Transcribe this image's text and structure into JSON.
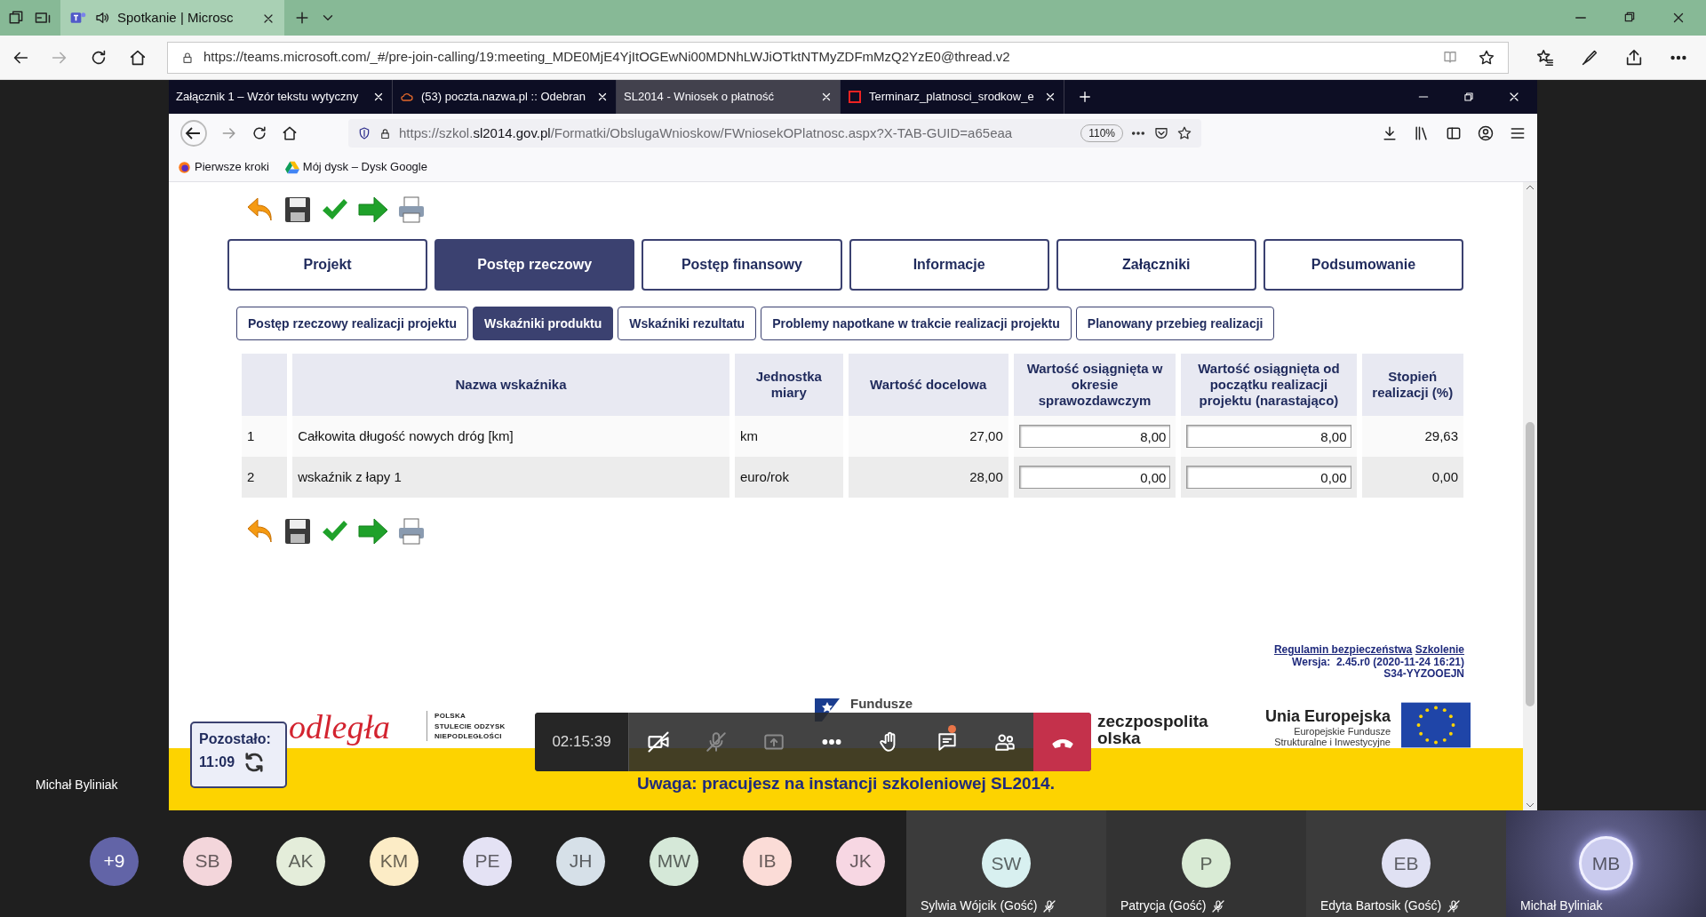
{
  "edge": {
    "tab_title": "Spotkanie | Microsc",
    "url": "https://teams.microsoft.com/_#/pre-join-calling/19:meeting_MDE0MjE4YjItOGEwNi00MDNhLWJiOTktNTMyZDFmMzQ2YzE0@thread.v2"
  },
  "firefox": {
    "tabs": [
      {
        "title": "Załącznik 1 – Wzór tekstu wytyczny",
        "selected": false,
        "kind": "plain"
      },
      {
        "title": "(53) poczta.nazwa.pl :: Odebran",
        "selected": false,
        "kind": "mail"
      },
      {
        "title": "SL2014 - Wniosek o płatność",
        "selected": true,
        "kind": "plain"
      },
      {
        "title": "Terminarz_platnosci_srodkow_e",
        "selected": false,
        "kind": "pdf"
      }
    ],
    "url": "https://szkol.**sl2014.gov.pl**/Formatki/ObslugaWnioskow/FWniosekOPlatnosc.aspx?X-TAB-GUID=a65eaa",
    "zoom": "110%",
    "bookmarks": [
      {
        "label": "Pierwsze kroki",
        "kind": "firefox"
      },
      {
        "label": "Mój dysk – Dysk Google",
        "kind": "drive"
      }
    ]
  },
  "page": {
    "main_tabs": [
      {
        "label": "Projekt",
        "selected": false
      },
      {
        "label": "Postęp rzeczowy",
        "selected": true
      },
      {
        "label": "Postęp finansowy",
        "selected": false
      },
      {
        "label": "Informacje",
        "selected": false
      },
      {
        "label": "Załączniki",
        "selected": false
      },
      {
        "label": "Podsumowanie",
        "selected": false
      }
    ],
    "sub_tabs": [
      {
        "label": "Postęp rzeczowy realizacji projektu",
        "selected": false
      },
      {
        "label": "Wskaźniki produktu",
        "selected": true
      },
      {
        "label": "Wskaźniki rezultatu",
        "selected": false
      },
      {
        "label": "Problemy napotkane w trakcie realizacji projektu",
        "selected": false
      },
      {
        "label": "Planowany przebieg realizacji",
        "selected": false
      }
    ],
    "table": {
      "columns": [
        "Nazwa wskaźnika",
        "Jednostka miary",
        "Wartość docelowa",
        "Wartość osiągnięta w okresie sprawozdawczym",
        "Wartość osiągnięta od początku realizacji projektu (narastająco)",
        "Stopień realizacji (%)"
      ],
      "rows": [
        {
          "no": "1",
          "name": "Całkowita długość nowych dróg [km]",
          "unit": "km",
          "target": "27,00",
          "period": "8,00",
          "cumulative": "8,00",
          "degree": "29,63"
        },
        {
          "no": "2",
          "name": "wskaźnik z łapy 1",
          "unit": "euro/rok",
          "target": "28,00",
          "period": "0,00",
          "cumulative": "0,00",
          "degree": "0,00"
        }
      ]
    },
    "footer": {
      "links": [
        "Regulamin bezpieczeństwa",
        "Szkolenie"
      ],
      "version": "Wersja:  2.45.r0 (2020-11-24 16:21)",
      "build": "S34-YYZOOEJN"
    },
    "logos": {
      "independence": "odległa",
      "centenary": [
        "POLSKA",
        "STULECIE ODZYSK",
        "NIEPODLEGŁOŚCI"
      ],
      "funds": [
        "Fundusze"
      ],
      "republic": [
        "zeczpospolita",
        "olska"
      ],
      "eu": [
        "Unia Europejska",
        "Europejskie Fundusze",
        "Strukturalne i Inwestycyjne"
      ]
    },
    "banner": "Uwaga: pracujesz na instancji szkoleniowej SL2014."
  },
  "call": {
    "timer": "02:15:39",
    "controls": [
      {
        "kind": "camera",
        "off": true,
        "disabled": false
      },
      {
        "kind": "mic",
        "off": true,
        "disabled": true
      },
      {
        "kind": "share",
        "disabled": true
      },
      {
        "kind": "more",
        "disabled": false
      },
      {
        "kind": "hand",
        "disabled": false
      },
      {
        "kind": "chat",
        "disabled": false,
        "unread": true
      },
      {
        "kind": "people",
        "disabled": false
      },
      {
        "kind": "hangup",
        "disabled": false
      }
    ],
    "countdown": {
      "label": "Pozostało:",
      "time": "11:09"
    },
    "presenter": "Michał Byliniak"
  },
  "participants": {
    "overflow": "+9",
    "avatars": [
      {
        "initials": "SB",
        "color": "#f3d6db"
      },
      {
        "initials": "AK",
        "color": "#e4edda"
      },
      {
        "initials": "KM",
        "color": "#fcecc6"
      },
      {
        "initials": "PE",
        "color": "#e4e2f4"
      },
      {
        "initials": "JH",
        "color": "#d6e0e8"
      },
      {
        "initials": "MW",
        "color": "#d5e8d8"
      },
      {
        "initials": "IB",
        "color": "#fbdcd7"
      },
      {
        "initials": "JK",
        "color": "#f7d7e3"
      }
    ],
    "tiles": [
      {
        "initials": "SW",
        "name": "Sylwia Wójcik (Gość)",
        "color": "#d8f0f0",
        "muted": true,
        "speaking": false
      },
      {
        "initials": "P",
        "name": "Patrycja (Gość)",
        "color": "#d9ebd5",
        "muted": true,
        "speaking": false
      },
      {
        "initials": "EB",
        "name": "Edyta Bartosik (Gość)",
        "color": "#e0e1f3",
        "muted": true,
        "speaking": false
      },
      {
        "initials": "MB",
        "name": "Michał Byliniak",
        "color": "#cacbee",
        "muted": false,
        "speaking": true
      }
    ]
  }
}
